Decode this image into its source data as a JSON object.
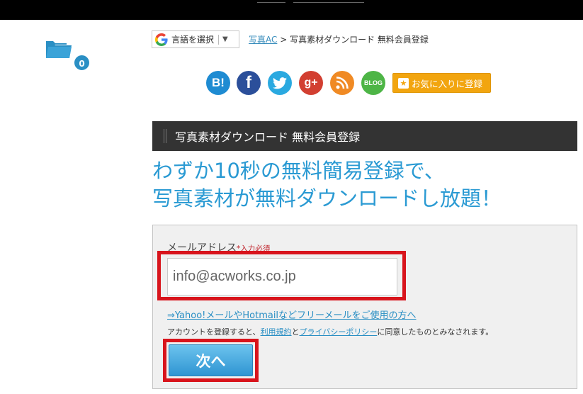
{
  "sidebar": {
    "folder_count": "0"
  },
  "translate": {
    "label": "言語を選択",
    "arrow": "▼"
  },
  "breadcrumb": {
    "home": "写真AC",
    "sep": " > ",
    "current": "写真素材ダウンロード 無料会員登録"
  },
  "social": {
    "hatena": "B!",
    "facebook": "f",
    "googleplus": "g+",
    "blog": "BLOG",
    "favorite_label": "お気に入りに登録"
  },
  "section": {
    "title": "写真素材ダウンロード 無料会員登録"
  },
  "headline": {
    "line1": "わずか10秒の無料簡易登録で、",
    "line2": "写真素材が無料ダウンロードし放題！"
  },
  "form": {
    "email_label": "メールアドレス",
    "required": "*入力必須",
    "email_value": "info@acworks.co.jp",
    "freemail_link": "⇒Yahoo!メールやHotmailなどフリーメールをご使用の方へ",
    "agree_prefix": "アカウントを登録すると、",
    "terms_link": "利用規約",
    "and": "と",
    "privacy_link": "プライバシーポリシー",
    "agree_suffix": "に同意したものとみなされます。",
    "next_button": "次へ"
  },
  "colors": {
    "accent": "#2a9ad3",
    "highlight": "#d8141c",
    "favorite": "#f2a50f"
  }
}
